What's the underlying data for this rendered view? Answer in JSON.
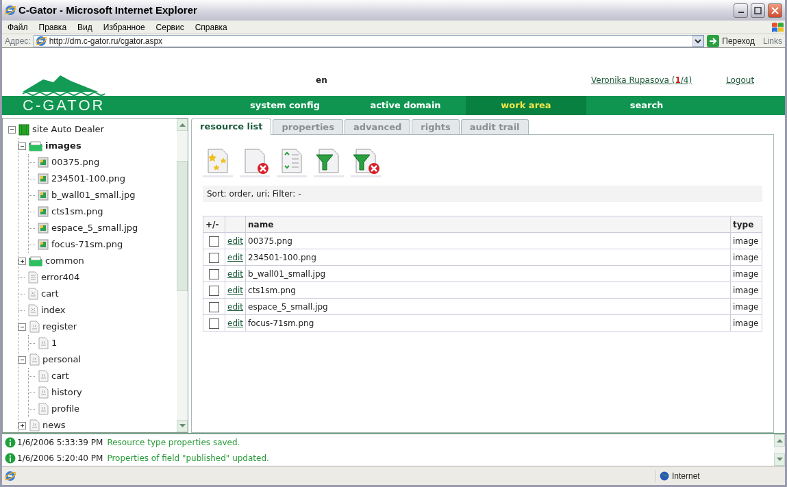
{
  "window": {
    "title": "C-Gator - Microsoft Internet Explorer"
  },
  "menu": [
    "Файл",
    "Правка",
    "Вид",
    "Избранное",
    "Сервис",
    "Справка"
  ],
  "address_bar": {
    "label": "Адрес:",
    "value": "http://dm.c-gator.ru/cgator.aspx",
    "go": "Переход",
    "links": "Links"
  },
  "header": {
    "logo": "C-GATOR",
    "language": "en",
    "user": "Veronika Rupasova",
    "sessions_open": "(",
    "sessions_current": "1",
    "sessions_rest": "/4)",
    "logout": "Logout"
  },
  "nav": [
    {
      "label": "system config",
      "selected": false
    },
    {
      "label": "active domain",
      "selected": false
    },
    {
      "label": "work area",
      "selected": true
    },
    {
      "label": "search",
      "selected": false
    }
  ],
  "tree": [
    {
      "label": "site Auto Dealer",
      "kind": "site",
      "expanded": true,
      "selected": false,
      "children": [
        {
          "label": "images",
          "kind": "folder",
          "expanded": true,
          "selected": true,
          "children": [
            {
              "label": "00375.png",
              "kind": "image",
              "selected": false
            },
            {
              "label": "234501-100.png",
              "kind": "image",
              "selected": false
            },
            {
              "label": "b_wall01_small.jpg",
              "kind": "image",
              "selected": false
            },
            {
              "label": "cts1sm.png",
              "kind": "image",
              "selected": false
            },
            {
              "label": "espace_5_small.jpg",
              "kind": "image",
              "selected": false
            },
            {
              "label": "focus-71sm.png",
              "kind": "image",
              "selected": false
            }
          ]
        },
        {
          "label": "common",
          "kind": "folder",
          "expanded": false,
          "selected": false
        },
        {
          "label": "error404",
          "kind": "text",
          "selected": false
        },
        {
          "label": "cart",
          "kind": "page",
          "selected": false
        },
        {
          "label": "index",
          "kind": "page",
          "selected": false
        },
        {
          "label": "register",
          "kind": "page",
          "expanded": true,
          "selected": false,
          "children": [
            {
              "label": "1",
              "kind": "page",
              "selected": false
            }
          ]
        },
        {
          "label": "personal",
          "kind": "page",
          "expanded": true,
          "selected": false,
          "children": [
            {
              "label": "cart",
              "kind": "page",
              "selected": false
            },
            {
              "label": "history",
              "kind": "page",
              "selected": false
            },
            {
              "label": "profile",
              "kind": "page",
              "selected": false
            }
          ]
        },
        {
          "label": "news",
          "kind": "page",
          "expanded": false,
          "selected": false
        }
      ]
    }
  ],
  "tabs": [
    {
      "label": "resource list",
      "selected": true
    },
    {
      "label": "properties",
      "selected": false
    },
    {
      "label": "advanced",
      "selected": false
    },
    {
      "label": "rights",
      "selected": false
    },
    {
      "label": "audit trail",
      "selected": false
    }
  ],
  "sort_filter": "Sort: order, uri; Filter: -",
  "table": {
    "columns": {
      "select": "+/-",
      "name": "name",
      "type": "type"
    },
    "rows": [
      {
        "checked": false,
        "action": "edit",
        "name": "00375.png",
        "type": "image"
      },
      {
        "checked": false,
        "action": "edit",
        "name": "234501-100.png",
        "type": "image"
      },
      {
        "checked": false,
        "action": "edit",
        "name": "b_wall01_small.jpg",
        "type": "image"
      },
      {
        "checked": false,
        "action": "edit",
        "name": "cts1sm.png",
        "type": "image"
      },
      {
        "checked": false,
        "action": "edit",
        "name": "espace_5_small.jpg",
        "type": "image"
      },
      {
        "checked": false,
        "action": "edit",
        "name": "focus-71sm.png",
        "type": "image"
      }
    ]
  },
  "log": [
    {
      "time": "1/6/2006 5:33:39 PM",
      "message": "Resource type properties saved."
    },
    {
      "time": "1/6/2006 5:20:40 PM",
      "message": "Properties of field \"published\" updated."
    }
  ],
  "status_bar": {
    "zone": "Internet"
  }
}
